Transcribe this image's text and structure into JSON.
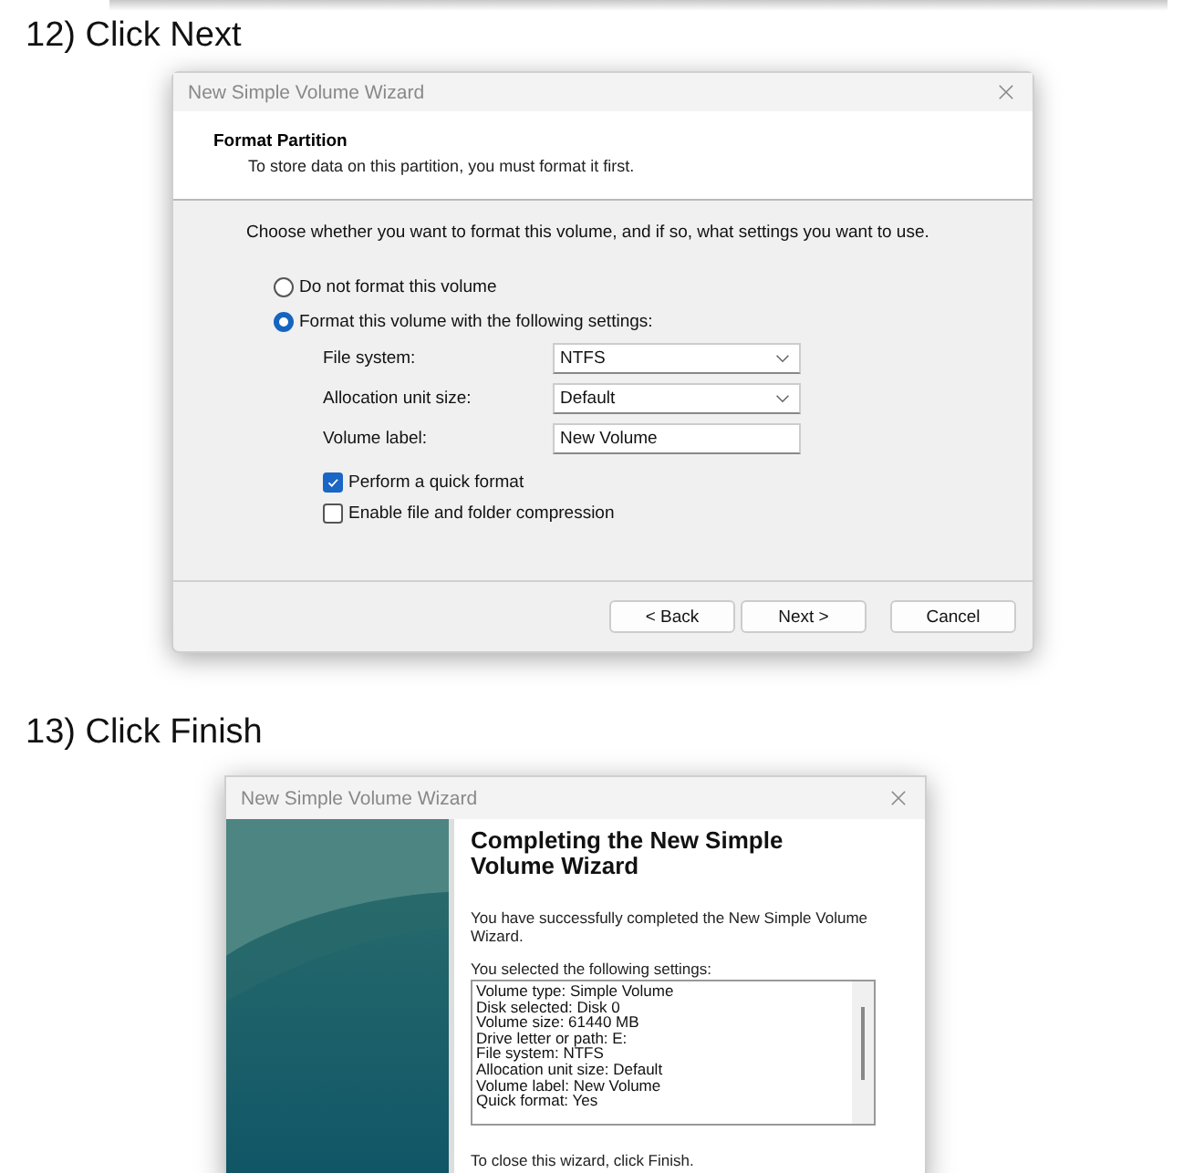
{
  "step_next": {
    "heading": "12) Click Next",
    "dialog": {
      "title": "New Simple Volume Wizard",
      "header_title": "Format Partition",
      "header_subtitle": "To store data on this partition, you must format it first.",
      "prompt": "Choose whether you want to format this volume, and if so, what settings you want to use.",
      "options": [
        {
          "label": "Do not format this volume",
          "selected": false
        },
        {
          "label": "Format this volume with the following settings:",
          "selected": true
        }
      ],
      "fields": [
        {
          "kind": "dropdown",
          "label": "File system:",
          "value": "NTFS"
        },
        {
          "kind": "dropdown",
          "label": "Allocation unit size:",
          "value": "Default"
        },
        {
          "kind": "text",
          "label": "Volume label:",
          "value": "New Volume"
        }
      ],
      "checkboxes": [
        {
          "label": "Perform a quick format",
          "checked": true
        },
        {
          "label": "Enable file and folder compression",
          "checked": false
        }
      ],
      "buttons": [
        "< Back",
        "Next >",
        "Cancel"
      ]
    }
  },
  "step_finish": {
    "heading": "13) Click Finish",
    "dialog": {
      "title": "New Simple Volume Wizard",
      "heading": "Completing the New Simple Volume Wizard",
      "message": "You have successfully completed the New Simple Volume Wizard.",
      "settings_label": "You selected the following settings:",
      "settings": [
        "Volume type: Simple Volume",
        "Disk selected: Disk 0",
        "Volume size: 61440 MB",
        "Drive letter or path: E:",
        "File system: NTFS",
        "Allocation unit size: Default",
        "Volume label: New Volume",
        "Quick format: Yes"
      ],
      "footer": "To close this wizard, click Finish."
    }
  }
}
